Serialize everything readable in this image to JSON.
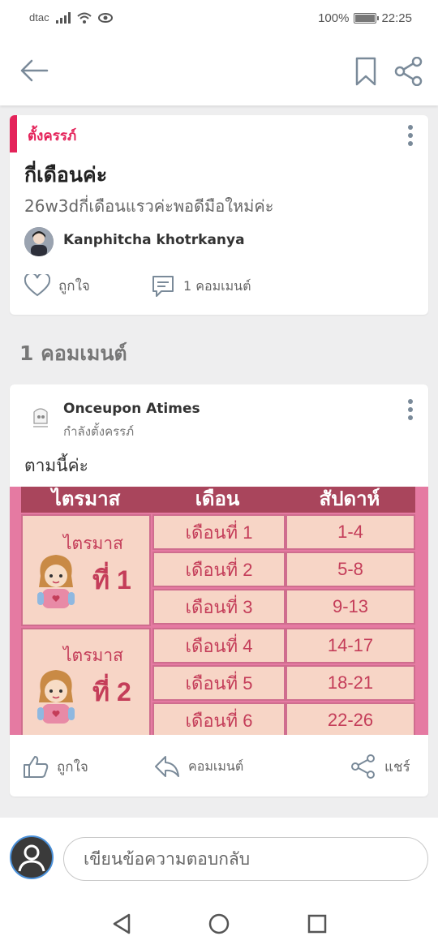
{
  "status_bar": {
    "carrier": "dtac",
    "battery": "100%",
    "time": "22:25"
  },
  "post": {
    "category": "ตั้งครรภ์",
    "title": "กี่เดือนค่ะ",
    "body": "26w3dกี่เดือนแรวค่ะพอดีมือใหม่ค่ะ",
    "author": "Kanphitcha khotrkanya",
    "like_label": "ถูกใจ",
    "comment_label": "1 คอมเมนต์"
  },
  "comments_heading": "1 คอมเมนต์",
  "comment": {
    "author": "Onceupon Atimes",
    "status": "กำลังตั้งครรภ์",
    "text": "ตามนี้ค่ะ",
    "like_label": "ถูกใจ",
    "reply_label": "คอมเมนต์",
    "share_label": "แชร์"
  },
  "image_table": {
    "headers": [
      "ไตรมาส",
      "เดือน",
      "สัปดาห์"
    ],
    "trimesters": [
      {
        "label": "ไตรมาส",
        "number": "ที่ 1",
        "rows": [
          {
            "month": "เดือนที่ 1",
            "weeks": "1-4"
          },
          {
            "month": "เดือนที่ 2",
            "weeks": "5-8"
          },
          {
            "month": "เดือนที่ 3",
            "weeks": "9-13"
          }
        ]
      },
      {
        "label": "ไตรมาส",
        "number": "ที่ 2",
        "rows": [
          {
            "month": "เดือนที่ 4",
            "weeks": "14-17"
          },
          {
            "month": "เดือนที่ 5",
            "weeks": "18-21"
          },
          {
            "month": "เดือนที่ 6",
            "weeks": "22-26"
          }
        ]
      }
    ]
  },
  "reply": {
    "placeholder": "เขียนข้อความตอบกลับ"
  },
  "colors": {
    "accent": "#e4235a",
    "icon": "#7a8a99",
    "table_header": "#a9455c",
    "table_cell": "#f7d5c6"
  },
  "icons": [
    "back-arrow-icon",
    "bookmark-icon",
    "share-icon",
    "kebab-menu-icon",
    "heart-icon",
    "comment-bubble-icon",
    "thumbs-up-icon",
    "reply-arrow-icon",
    "user-icon",
    "nav-back-icon",
    "nav-home-icon",
    "nav-recents-icon"
  ]
}
